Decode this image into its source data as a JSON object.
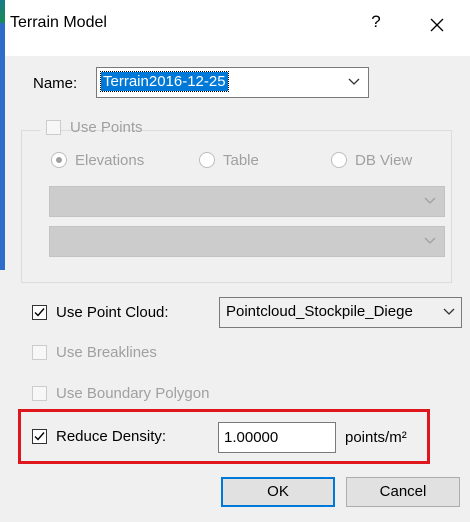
{
  "dialog": {
    "title": "Terrain Model",
    "help_label": "?",
    "close_icon": "close-icon"
  },
  "name_field": {
    "label": "Name:",
    "value": "Terrain2016-12-25"
  },
  "use_points": {
    "label": "Use Points",
    "checked": false,
    "enabled": false,
    "radio_elevations": "Elevations",
    "radio_table": "Table",
    "radio_db_view": "DB View",
    "selected_radio": "Elevations",
    "combo1_value": "",
    "combo2_value": ""
  },
  "point_cloud": {
    "label": "Use Point Cloud:",
    "checked": true,
    "value": "Pointcloud_Stockpile_Diege"
  },
  "breaklines": {
    "label": "Use Breaklines",
    "checked": false,
    "enabled": false
  },
  "boundary": {
    "label": "Use Boundary Polygon",
    "checked": false,
    "enabled": false
  },
  "reduce_density": {
    "label": "Reduce Density:",
    "checked": true,
    "value": "1.00000",
    "unit": "points/m²"
  },
  "buttons": {
    "ok": "OK",
    "cancel": "Cancel"
  },
  "colors": {
    "highlight": "#e0161d",
    "selection": "#0078d7"
  }
}
